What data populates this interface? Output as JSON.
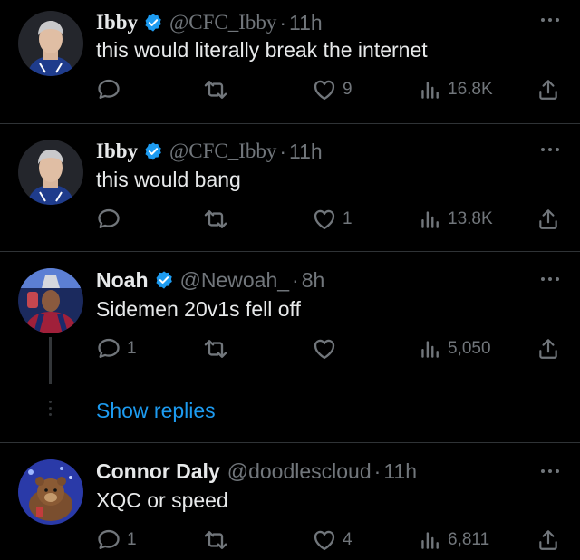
{
  "colors": {
    "background": "#000000",
    "text": "#e7e9ea",
    "muted": "#71767b",
    "link": "#1d9bf0",
    "verified_badge": "#1d9bf0",
    "divider": "#2f3336"
  },
  "icons": {
    "reply": "speech-bubble",
    "retweet": "retweet-arrows",
    "like": "heart-outline",
    "views": "bar-chart",
    "share": "upload-arrow",
    "more": "three-dots",
    "verified": "blue-check-badge"
  },
  "tweets": [
    {
      "name": "Ibby",
      "handle": "@CFC_Ibby",
      "separator": "·",
      "time": "11h",
      "text": "this would literally break the internet",
      "replies": "",
      "retweets": "",
      "likes": "9",
      "views": "16.8K",
      "verified": true
    },
    {
      "name": "Ibby",
      "handle": "@CFC_Ibby",
      "separator": "·",
      "time": "11h",
      "text": "this would bang",
      "replies": "",
      "retweets": "",
      "likes": "1",
      "views": "13.8K",
      "verified": true
    },
    {
      "name": "Noah",
      "handle": "@Newoah_",
      "separator": "·",
      "time": "8h",
      "text": "Sidemen 20v1s fell off",
      "replies": "1",
      "retweets": "",
      "likes": "",
      "views": "5,050",
      "verified": true
    },
    {
      "name": "Connor Daly",
      "handle": "@doodlescloud",
      "separator": "·",
      "time": "11h",
      "text": "XQC or speed",
      "replies": "1",
      "retweets": "",
      "likes": "4",
      "views": "6,811",
      "verified": false
    }
  ],
  "thread": {
    "show_replies": "Show replies"
  }
}
